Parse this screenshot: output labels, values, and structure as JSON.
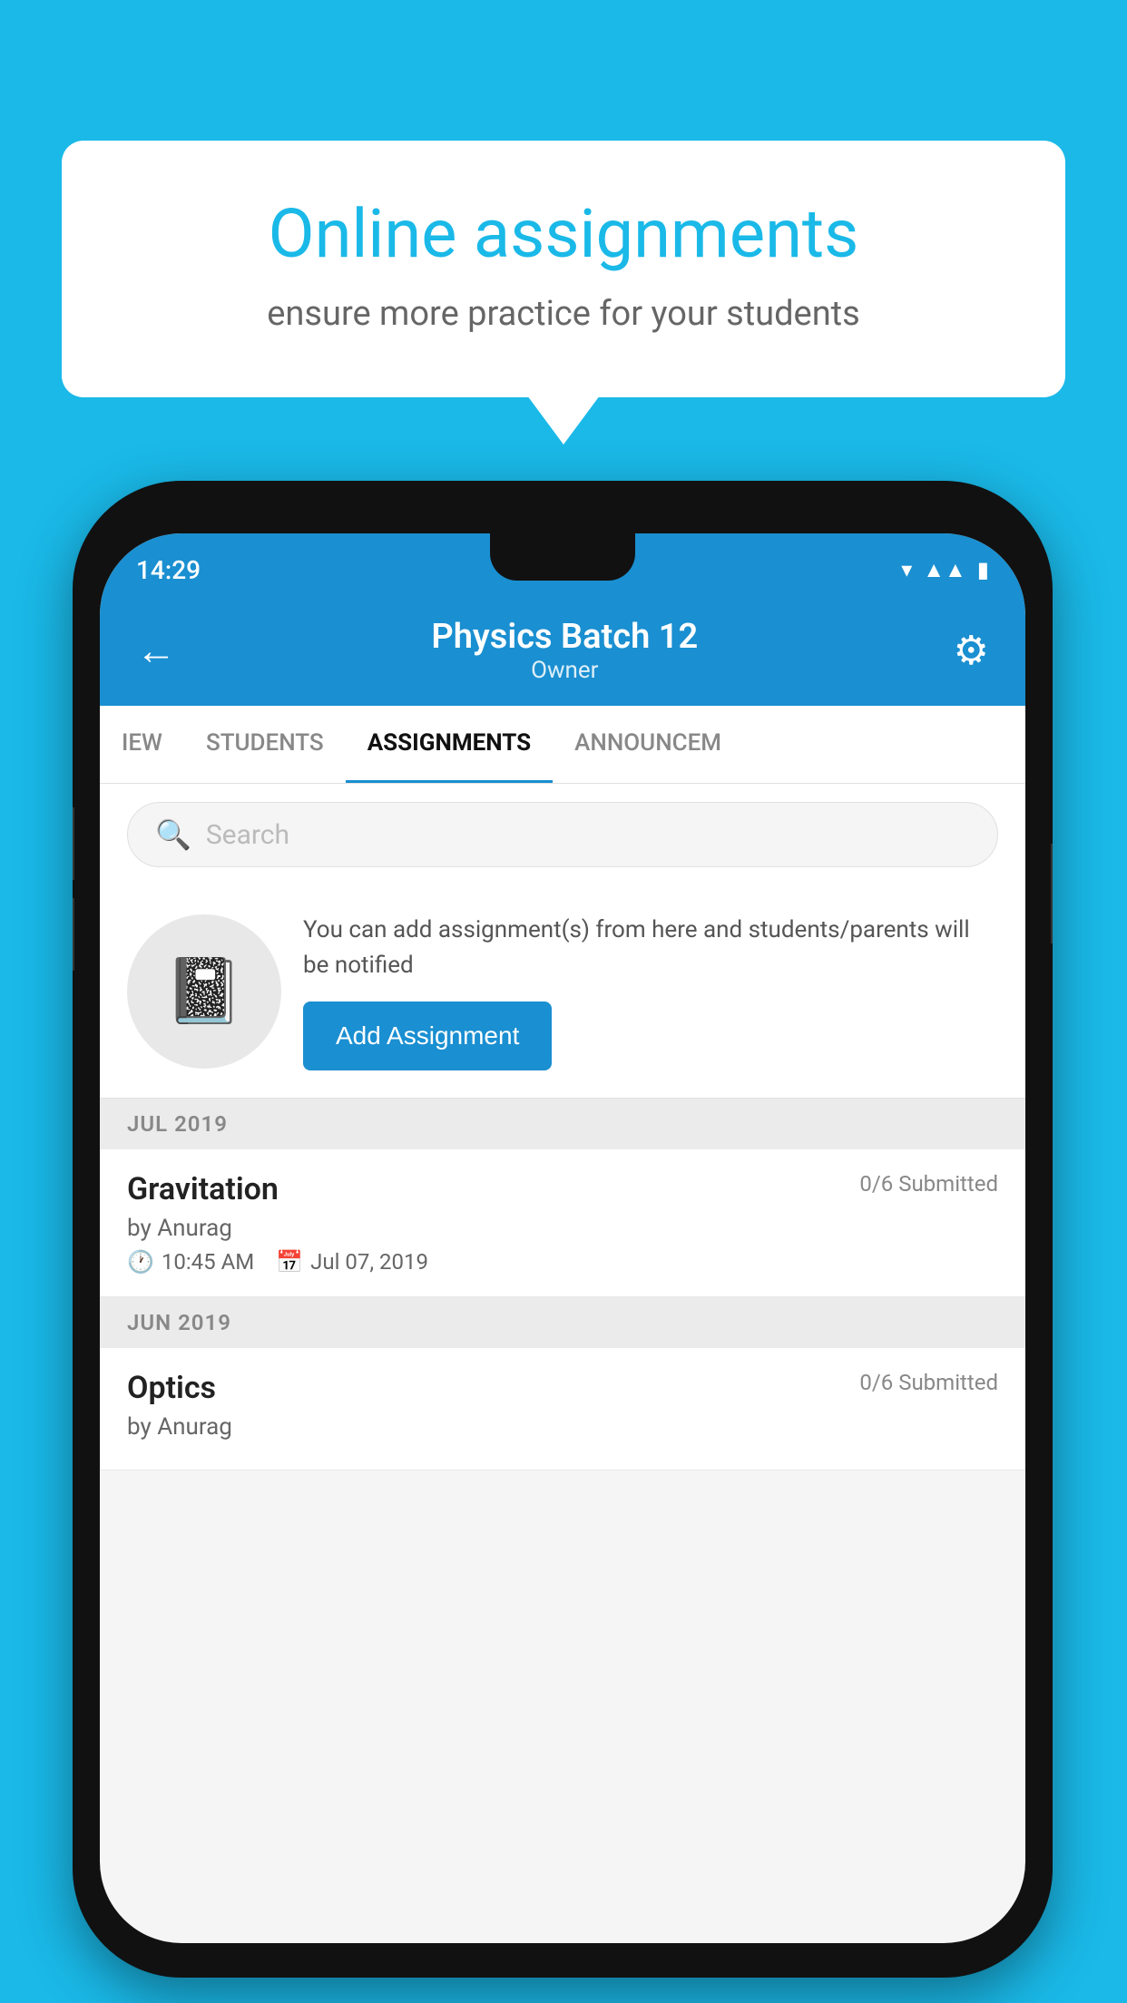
{
  "background_color": "#1ab9e8",
  "speech_bubble": {
    "title": "Online assignments",
    "subtitle": "ensure more practice for your students"
  },
  "status_bar": {
    "time": "14:29",
    "icons": [
      "wifi",
      "signal",
      "battery"
    ]
  },
  "header": {
    "title": "Physics Batch 12",
    "subtitle": "Owner",
    "back_label": "←",
    "gear_label": "⚙"
  },
  "tabs": [
    {
      "label": "IEW",
      "active": false
    },
    {
      "label": "STUDENTS",
      "active": false
    },
    {
      "label": "ASSIGNMENTS",
      "active": true
    },
    {
      "label": "ANNOUNCEM",
      "active": false
    }
  ],
  "search": {
    "placeholder": "Search"
  },
  "promo": {
    "description": "You can add assignment(s) from here and students/parents will be notified",
    "button_label": "Add Assignment"
  },
  "assignment_groups": [
    {
      "month_label": "JUL 2019",
      "assignments": [
        {
          "name": "Gravitation",
          "submitted": "0/6 Submitted",
          "by": "by Anurag",
          "time": "10:45 AM",
          "date": "Jul 07, 2019"
        }
      ]
    },
    {
      "month_label": "JUN 2019",
      "assignments": [
        {
          "name": "Optics",
          "submitted": "0/6 Submitted",
          "by": "by Anurag",
          "time": "",
          "date": ""
        }
      ]
    }
  ]
}
